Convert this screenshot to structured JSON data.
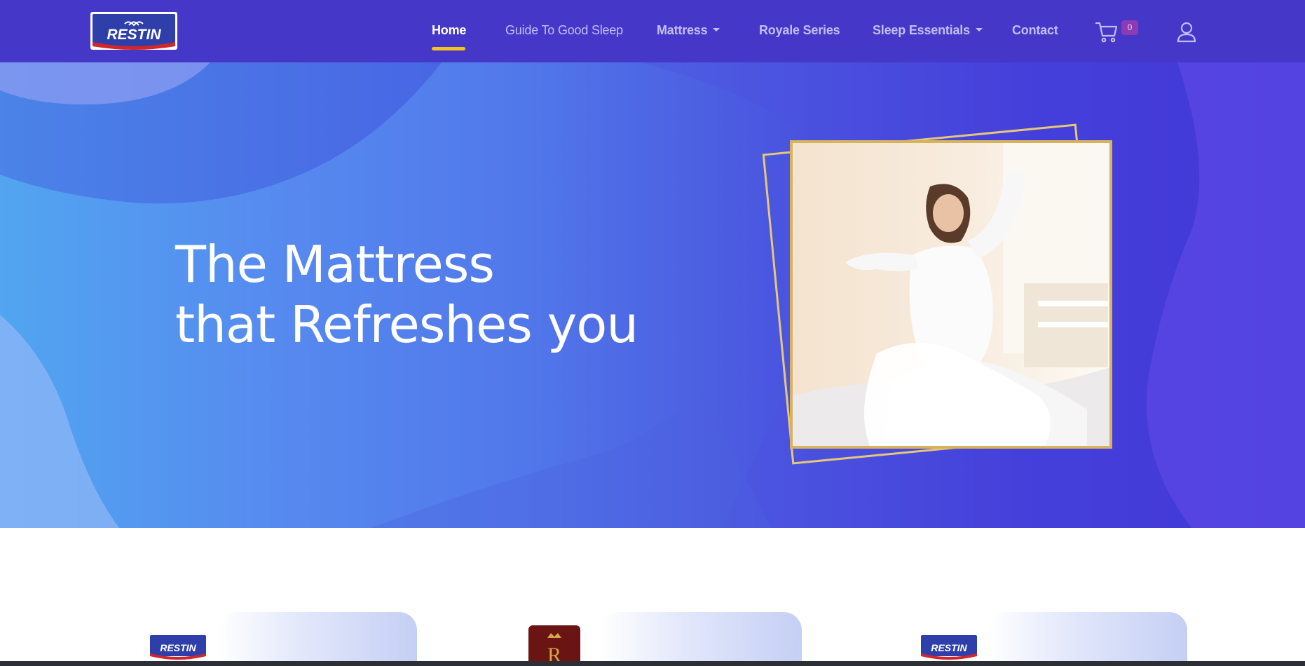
{
  "brand": {
    "logo_text": "RESTIN",
    "color_primary": "#4538c9",
    "accent": "#f5c31f"
  },
  "nav": {
    "items": [
      {
        "label": "Home",
        "active": true
      },
      {
        "label": "Guide To Good Sleep"
      },
      {
        "label": "Mattress",
        "dropdown": true
      },
      {
        "label": "Royale Series"
      },
      {
        "label": "Sleep Essentials",
        "dropdown": true
      },
      {
        "label": "Contact"
      }
    ],
    "cart_count": "0",
    "icons": {
      "cart": "cart-icon",
      "user": "user-icon"
    }
  },
  "hero": {
    "headline_line1": "The Mattress",
    "headline_line2": "that Refreshes you",
    "image": "woman-stretching-in-bed-photo"
  },
  "cards": [
    {
      "logo_text": "RESTIN"
    },
    {
      "logo_text": "R"
    },
    {
      "logo_text": "RESTIN"
    }
  ]
}
